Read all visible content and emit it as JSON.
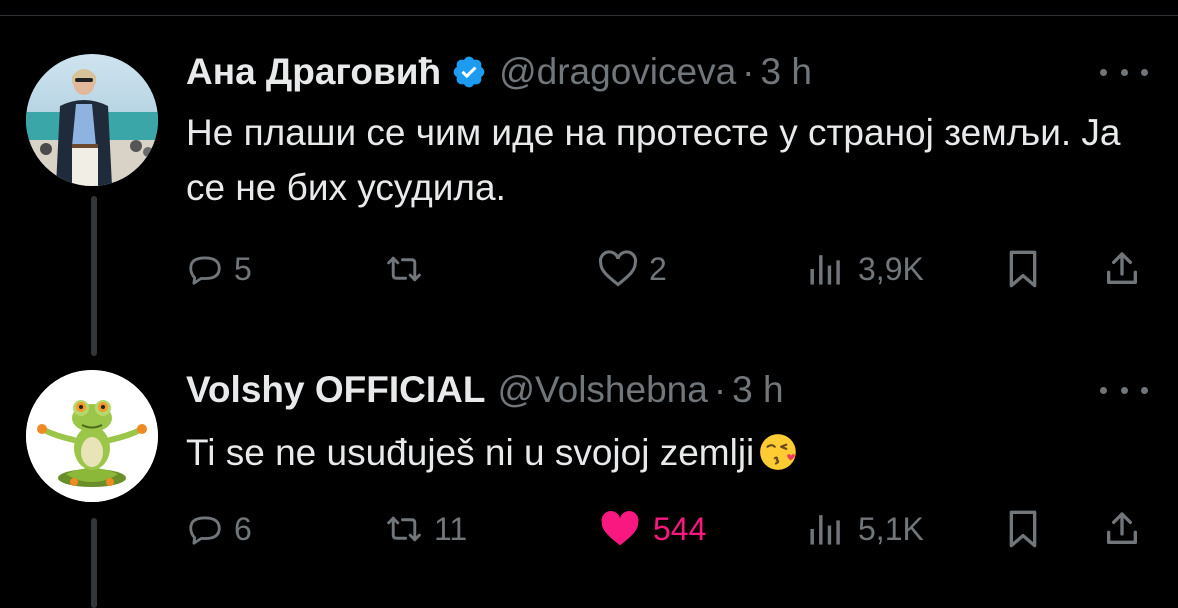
{
  "tweets": [
    {
      "display_name": "Ана Драговић",
      "verified": true,
      "handle": "@dragoviceva",
      "separator": "·",
      "time": "3 h",
      "text": "Не плаши се чим иде на протесте у страној земљи. Ја се не бих усудила.",
      "replies": "5",
      "retweets": "",
      "likes": "2",
      "views": "3,9K",
      "liked": false,
      "avatar_icon": "person-photo"
    },
    {
      "display_name": "Volshy OFFICIAL",
      "verified": false,
      "handle": "@Volshebna",
      "separator": "·",
      "time": "3 h",
      "text": "Ti se ne usuđuješ ni u svojoj zemlji",
      "text_emoji": "face-blowing-kiss-emoji",
      "replies": "6",
      "retweets": "11",
      "likes": "544",
      "views": "5,1K",
      "liked": true,
      "avatar_icon": "frog-meditating"
    }
  ],
  "colors": {
    "background": "#000000",
    "text": "#e7e9ea",
    "muted": "#71767b",
    "verified": "#1d9bf0",
    "like_active": "#f91880"
  }
}
